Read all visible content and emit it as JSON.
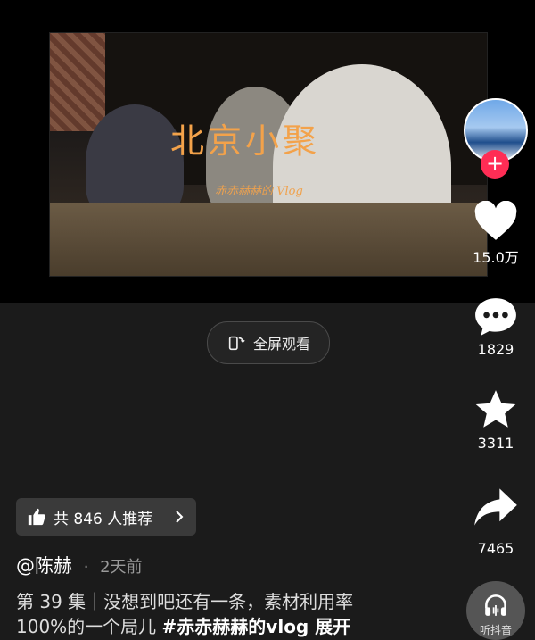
{
  "video": {
    "title": "北京小聚",
    "subtitle": "赤赤赫赫的 Vlog"
  },
  "fullscreen": {
    "label": "全屏观看"
  },
  "actions": {
    "like_count": "15.0万",
    "comment_count": "1829",
    "favorite_count": "3311",
    "share_count": "7465"
  },
  "recommend": {
    "label": "共 846 人推荐"
  },
  "author": {
    "name": "@陈赫",
    "time": "2天前"
  },
  "description": {
    "line1": "第 39 集｜没想到吧还有一条，素材利用率",
    "line2_text": "100%的一个局儿 ",
    "line2_tag": "#赤赤赫赫的vlog",
    "line2_more": "  展开"
  },
  "listen": {
    "label": "听抖音"
  },
  "colors": {
    "accent": "#ff2d55",
    "title_orange": "#f3a24a"
  }
}
